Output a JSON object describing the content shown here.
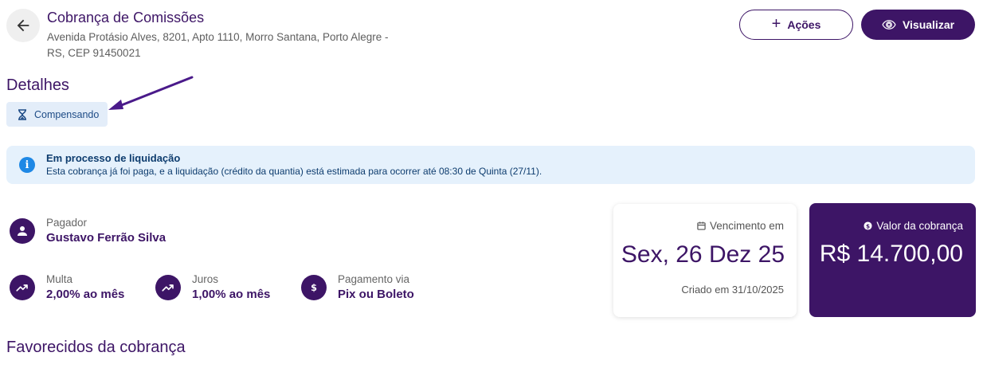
{
  "header": {
    "title": "Cobrança de Comissões",
    "address": "Avenida Protásio Alves, 8201, Apto 1110, Morro Santana, Porto Alegre - RS, CEP 91450021",
    "actions_label": "Ações",
    "view_label": "Visualizar"
  },
  "details": {
    "title": "Detalhes",
    "status": "Compensando"
  },
  "banner": {
    "title": "Em processo de liquidação",
    "description": "Esta cobrança já foi paga, e a liquidação (crédito da quantia) está estimada para ocorrer até 08:30 de Quinta (27/11)."
  },
  "payer": {
    "label": "Pagador",
    "value": "Gustavo Ferrão Silva"
  },
  "fine": {
    "label": "Multa",
    "value": "2,00% ao mês"
  },
  "interest": {
    "label": "Juros",
    "value": "1,00% ao mês"
  },
  "payment": {
    "label": "Pagamento via",
    "value": "Pix ou Boleto"
  },
  "due": {
    "label": "Vencimento em",
    "date": "Sex, 26 Dez 25",
    "created": "Criado em 31/10/2025"
  },
  "amount": {
    "label": "Valor da cobrança",
    "value": "R$ 14.700,00"
  },
  "favored": {
    "title": "Favorecidos da cobrança"
  },
  "colors": {
    "primary": "#3d1566",
    "info_bg": "#e5f1fc",
    "info_icon": "#1e88e5",
    "badge_bg": "#e3edf9"
  }
}
